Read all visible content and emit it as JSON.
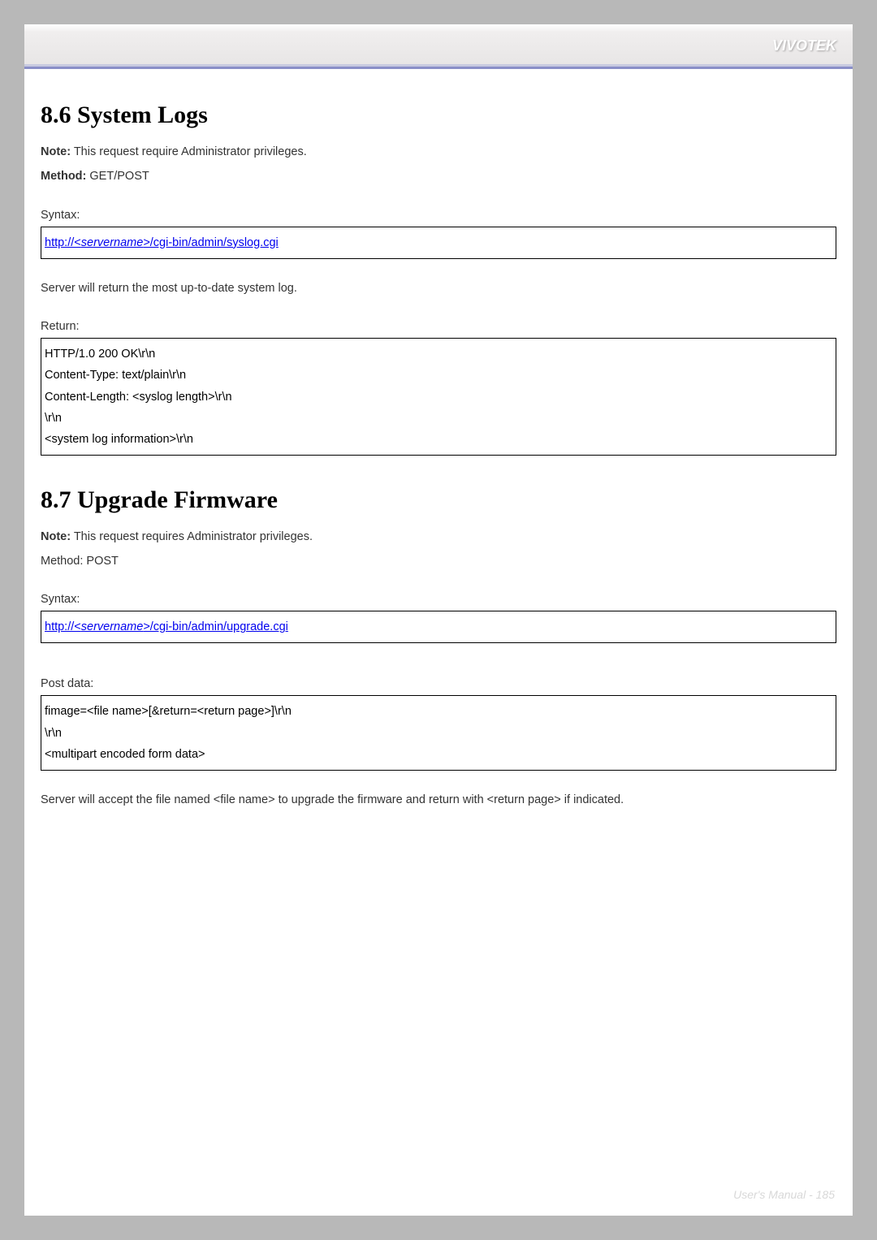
{
  "brand": "VIVOTEK",
  "section1": {
    "heading": "8.6 System Logs",
    "note_label": "Note:",
    "note_text": " This request require Administrator privileges.",
    "method_label": "Method:",
    "method_text": " GET/POST",
    "syntax_label": "Syntax:",
    "url_prefix": "http://<",
    "url_placeholder": "servername",
    "url_suffix": ">/cgi-bin/admin/syslog.cgi",
    "desc": "Server will return the most up-to-date system log.",
    "return_label": "Return:",
    "return_lines": [
      "HTTP/1.0 200 OK\\r\\n",
      "Content-Type: text/plain\\r\\n",
      "Content-Length: <syslog length>\\r\\n",
      "\\r\\n",
      "<system log information>\\r\\n"
    ]
  },
  "section2": {
    "heading": "8.7 Upgrade Firmware",
    "note_label": "Note:",
    "note_text": " This request requires Administrator privileges.",
    "method_line": "Method: POST",
    "syntax_label": "Syntax:",
    "url_prefix": "http://<",
    "url_placeholder": "servername",
    "url_suffix": ">/cgi-bin/admin/upgrade.cgi",
    "post_label": "Post data:",
    "post_lines": [
      "fimage=<file name>[&return=<return page>]\\r\\n",
      "\\r\\n",
      "<multipart encoded form data>"
    ],
    "desc": "Server will accept the file named <file name> to upgrade the firmware and return with <return page> if indicated."
  },
  "footer": "User's Manual - 185"
}
